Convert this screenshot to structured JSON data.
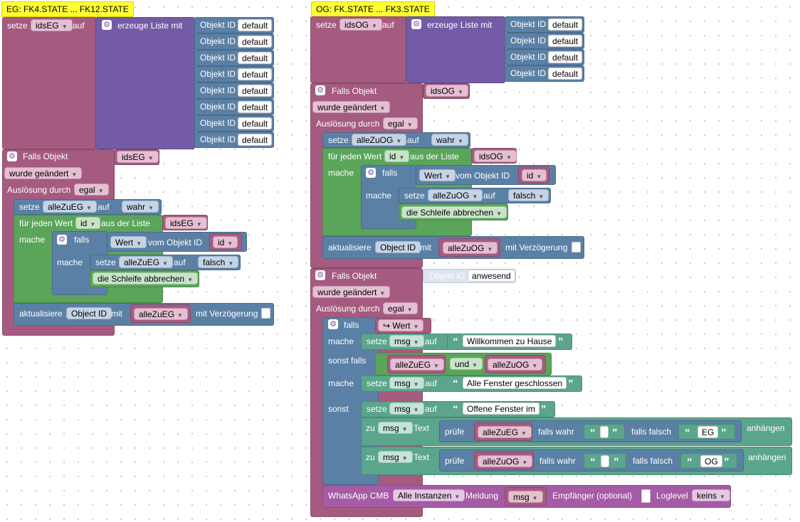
{
  "comments": {
    "eg": "EG: FK4.STATE ... FK12.STATE",
    "og": "OG: FK.STATE ... FK3.STATE"
  },
  "common": {
    "setze": "setze",
    "auf": "auf",
    "create_list": "erzeuge Liste mit",
    "object_id": "Objekt ID",
    "default_val": "default",
    "falls_objekt": "Falls Objekt",
    "wurde_geaendert": "wurde geändert",
    "ausloesung": "Auslösung durch",
    "egal": "egal",
    "fuer_jeden": "für jeden Wert",
    "id": "id",
    "aus_der_liste": "aus der Liste",
    "mache": "mache",
    "falls": "falls",
    "wert": "Wert",
    "vom_objekt": "vom Objekt ID",
    "break_loop": "die Schleife abbrechen",
    "aktualisiere": "aktualisiere",
    "object_id_en": "Object ID",
    "mit": "mit",
    "mit_verz": "mit Verzögerung",
    "wahr": "wahr",
    "falsch": "falsch",
    "sonst_falls": "sonst falls",
    "sonst": "sonst",
    "und": "und",
    "zu": "zu",
    "text": "Text",
    "pruefe": "prüfe",
    "falls_wahr": "falls wahr",
    "falls_falsch": "falls falsch",
    "anhaengen": "anhängen",
    "msg": "msg",
    "anwesend": "anwesend"
  },
  "vars": {
    "idsEG": "idsEG",
    "idsOG": "idsOG",
    "alleZuEG": "alleZuEG",
    "alleZuOG": "alleZuOG",
    "EG": "EG",
    "OG": "OG"
  },
  "strings": {
    "willkommen": "Willkommen zu Hause",
    "geschlossen": "Alle Fenster geschlossen",
    "offen": "Offene Fenster im"
  },
  "whatsapp": {
    "label": "WhatsApp CMB",
    "instances": "Alle Instanzen",
    "meldung": "Meldung",
    "empfaenger": "Empfänger (optional)",
    "loglevel": "Loglevel",
    "keins": "keins"
  },
  "icons": {
    "arrow": "↪",
    "gear": "⚙"
  }
}
